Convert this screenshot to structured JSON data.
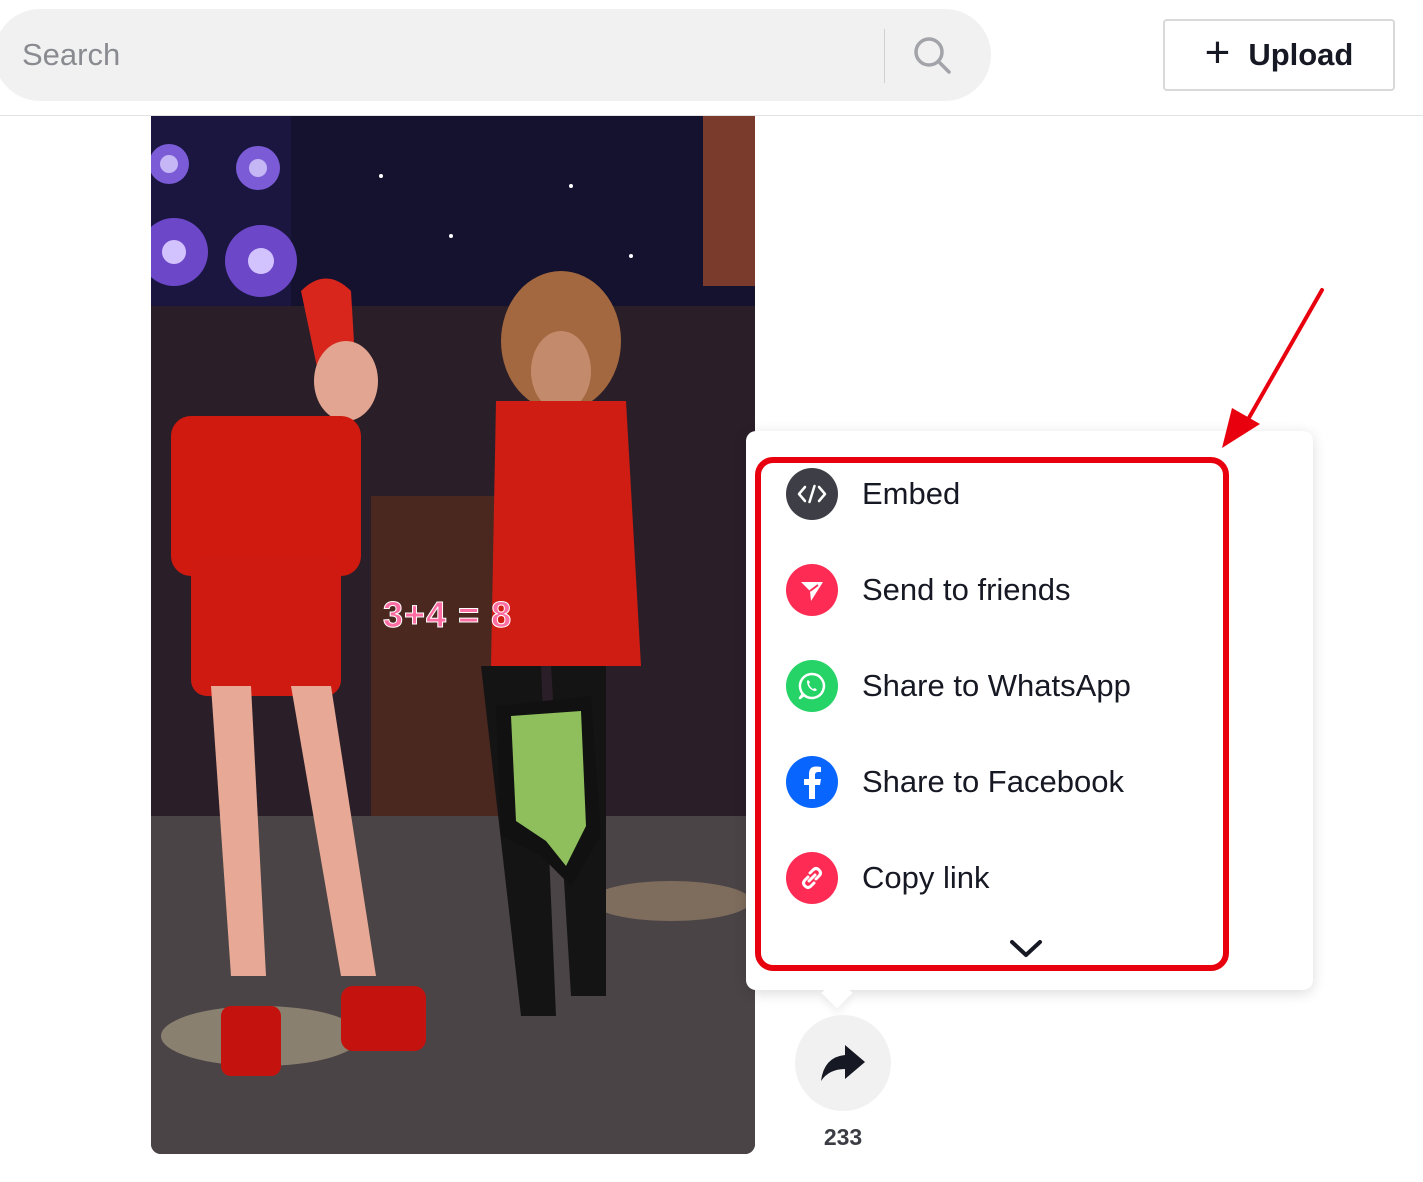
{
  "header": {
    "search_placeholder": "Search",
    "upload_label": "Upload",
    "icons": {
      "search": "search-icon",
      "upload": "plus-icon"
    }
  },
  "video": {
    "overlay_text": "3+4 = 8"
  },
  "share_menu": {
    "items": [
      {
        "label": "Embed",
        "icon": "embed-icon",
        "color": "#3e3f46"
      },
      {
        "label": "Send to friends",
        "icon": "send-icon",
        "color": "#fe2c55"
      },
      {
        "label": "Share to WhatsApp",
        "icon": "whatsapp-icon",
        "color": "#25d366"
      },
      {
        "label": "Share to Facebook",
        "icon": "facebook-icon",
        "color": "#0866ff"
      },
      {
        "label": "Copy link",
        "icon": "link-icon",
        "color": "#fe2c55"
      }
    ],
    "more_icon": "chevron-down-icon"
  },
  "share_action": {
    "count": "233",
    "icon": "share-arrow-icon"
  },
  "annotation": {
    "color": "#e8000e"
  }
}
